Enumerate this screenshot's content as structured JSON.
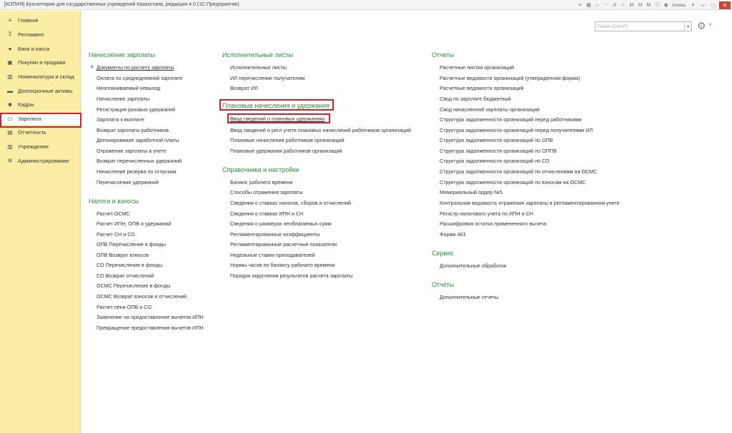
{
  "window": {
    "title": "[КОПИЯ] Бухгалтерия для государственных учреждений Казахстана, редакция 4.0  (1С:Предприятие)",
    "user": "Алина"
  },
  "sidebar": {
    "items": [
      {
        "label": "Главное",
        "icon": "menu-icon"
      },
      {
        "label": "Регламент",
        "icon": "regulation-icon"
      },
      {
        "label": "Банк и касса",
        "icon": "bank-icon"
      },
      {
        "label": "Покупки и продажи",
        "icon": "cart-icon"
      },
      {
        "label": "Номенклатура и склад",
        "icon": "warehouse-icon"
      },
      {
        "label": "Долгосрочные активы",
        "icon": "truck-icon"
      },
      {
        "label": "Кадры",
        "icon": "people-icon"
      },
      {
        "label": "Зарплата",
        "icon": "salary-icon"
      },
      {
        "label": "Отчетность",
        "icon": "reports-icon"
      },
      {
        "label": "Учреждение",
        "icon": "institution-icon"
      },
      {
        "label": "Администрирование",
        "icon": "gear-icon"
      }
    ]
  },
  "search": {
    "placeholder": "Поиск (Ctrl+F)"
  },
  "sections": {
    "nachislenie": {
      "title": "Начисление зарплаты",
      "items": [
        "Документы по расчету зарплаты",
        "Оплата по среднедневной зарплате",
        "Неоплачиваемый невыход",
        "Начисление зарплаты",
        "Регистрация разовых удержаний",
        "Зарплата к выплате",
        "Возврат зарплаты работников",
        "Депонирование заработной платы",
        "Отражение зарплаты в учете",
        "Возврат перечисленных удержаний",
        "Начисление резерва по отпускам",
        "Перечисление удержаний"
      ]
    },
    "nalogi": {
      "title": "Налоги и взносы",
      "items": [
        "Расчет ОСМС",
        "Расчет ИПН, ОПВ и удержаний",
        "Расчет СН и СО",
        "ОПВ Перечисление в фонды",
        "ОПВ Возврат взносов",
        "СО Перечисление в фонды",
        "СО Возврат отчислений",
        "ОСМС Перечисление в фонды",
        "ОСМС Возврат взносов и отчислений",
        "Расчет пени ОПВ и СО",
        "Заявление на предоставление вычетов ИПН",
        "Прекращение предоставления вычетов ИПН"
      ]
    },
    "ispolnitelnye": {
      "title": "Исполнительные листы",
      "items": [
        "Исполнительные листы",
        "ИЛ перечисление получателям",
        "Возврат ИЛ"
      ]
    },
    "planovye": {
      "title": "Плановые начисления и удержания",
      "items": [
        "Ввод сведений о плановых удержаниях",
        "Ввод сведений о регл учете плановых начислений работников организаций",
        "Плановые начисления работников организаций",
        "Плановые удержания работников организаций"
      ]
    },
    "spravochniki": {
      "title": "Справочники и настройки",
      "items": [
        "Баланс рабочего времени",
        "Способы отражения зарплаты",
        "Сведения о ставках налогов, сборов и отчислений",
        "Сведения о ставках ИПН и СН",
        "Сведения о размерах необлагаемых сумм",
        "Регламентированные коэффициенты",
        "Регламентированные расчетные показатели",
        "Недельные ставки преподавателей",
        "Нормы часов по балансу рабочего времени",
        "Порядок округления результатов расчета зарплаты"
      ]
    },
    "otchety": {
      "title": "Отчеты",
      "items": [
        "Расчетные листки организаций",
        "Расчетные ведомости организаций (утвержденная форма)",
        "Расчетные ведомости организаций",
        "Свод по зарплате бюджетный",
        "Свод начисленной зарплаты организаций",
        "Структура задолженности организаций перед работниками",
        "Структура задолженности организаций перед получателями ИЛ",
        "Структура задолженности организаций по ОПВ",
        "Структура задолженности организаций по ОППВ",
        "Структура задолженности организаций по СО",
        "Структура задолженности организаций по отчислениям на ОСМС",
        "Структура задолженности организаций по взносам на ОСМС",
        "Мемориальный ордер №5",
        "Контрольная ведомость отражения зарплаты в регламентированном учете",
        "Регистр налогового учета по ИПН и СН",
        "Расшифровка остатка примененного вычета",
        "Форма 463"
      ]
    },
    "servis": {
      "title": "Сервис",
      "items": [
        "Дополнительные обработки"
      ]
    },
    "otchety2": {
      "title": "Отчеты",
      "items": [
        "Дополнительные отчеты"
      ]
    }
  },
  "colors": {
    "sidebar_bg": "#fbeda4",
    "section_heading": "#2e8b3a",
    "highlight": "#d3202a"
  }
}
